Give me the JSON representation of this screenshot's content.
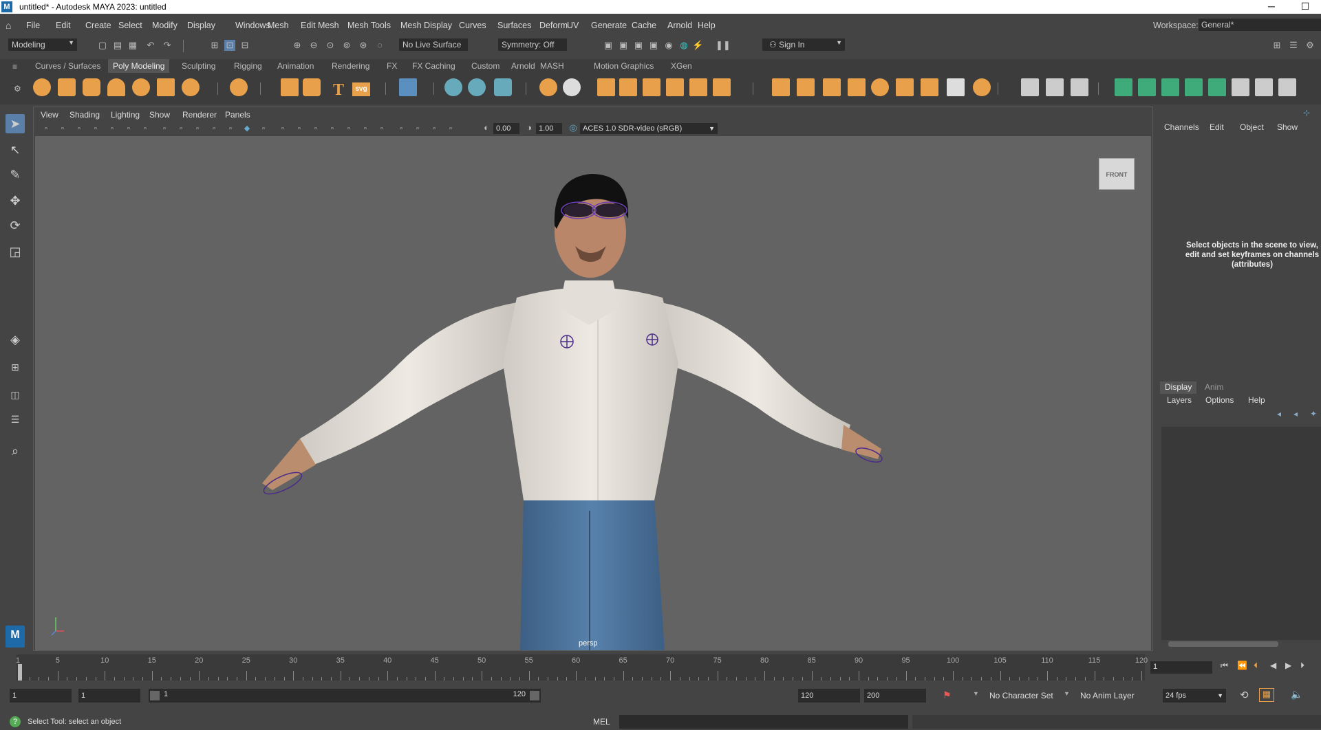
{
  "window": {
    "title": "untitled* - Autodesk MAYA 2023: untitled",
    "app_badge": "M"
  },
  "menubar": {
    "items": [
      "File",
      "Edit",
      "Create",
      "Select",
      "Modify",
      "Display",
      "Windows",
      "Mesh",
      "Edit Mesh",
      "Mesh Tools",
      "Mesh Display",
      "Curves",
      "Surfaces",
      "Deform",
      "UV",
      "Generate",
      "Cache",
      "Arnold",
      "Help"
    ],
    "workspace_label": "Workspace:",
    "workspace_value": "General*"
  },
  "statusline": {
    "menuset": "Modeling",
    "live_surface": "No Live Surface",
    "symmetry": "Symmetry: Off",
    "sign_in": "Sign In"
  },
  "shelf": {
    "tabs": [
      "Curves / Surfaces",
      "Poly Modeling",
      "Sculpting",
      "Rigging",
      "Animation",
      "Rendering",
      "FX",
      "FX Caching",
      "Custom",
      "Arnold",
      "MASH",
      "Motion Graphics",
      "XGen"
    ],
    "active_tab": "Poly Modeling",
    "svg_label": "svg",
    "text_label": "T"
  },
  "panel": {
    "menus": [
      "View",
      "Shading",
      "Lighting",
      "Show",
      "Renderer",
      "Panels"
    ],
    "exposure": "0.00",
    "gamma": "1.00",
    "color_space": "ACES 1.0 SDR-video (sRGB)",
    "camera": "persp",
    "viewcube": "FRONT"
  },
  "channelbox": {
    "menus": [
      "Channels",
      "Edit",
      "Object",
      "Show"
    ],
    "message": "Select objects in the scene to view, edit and set keyframes on channels (attributes)"
  },
  "layers": {
    "tabs": [
      "Display",
      "Anim"
    ],
    "active_tab": "Display",
    "menus": [
      "Layers",
      "Options",
      "Help"
    ]
  },
  "timeslider": {
    "ticks": [
      "5",
      "10",
      "15",
      "20",
      "25",
      "30",
      "35",
      "40",
      "45",
      "50",
      "55",
      "60",
      "65",
      "70",
      "75",
      "80",
      "85",
      "90",
      "95",
      "100",
      "105",
      "110",
      "115",
      "120"
    ],
    "first": "1",
    "current_frame": "1"
  },
  "range": {
    "start": "1",
    "playback_start": "1",
    "slider_start": "1",
    "slider_end": "120",
    "playback_end": "120",
    "end": "200",
    "character_set": "No Character Set",
    "anim_layer": "No Anim Layer",
    "fps": "24 fps"
  },
  "cmdline": {
    "help_text": "Select Tool: select an object",
    "lang": "MEL"
  },
  "colors": {
    "accent": "#5a7fa8",
    "shelf_orange": "#e8a04a",
    "shelf_green": "#3faa7a",
    "viewport_bg": "#636363"
  }
}
